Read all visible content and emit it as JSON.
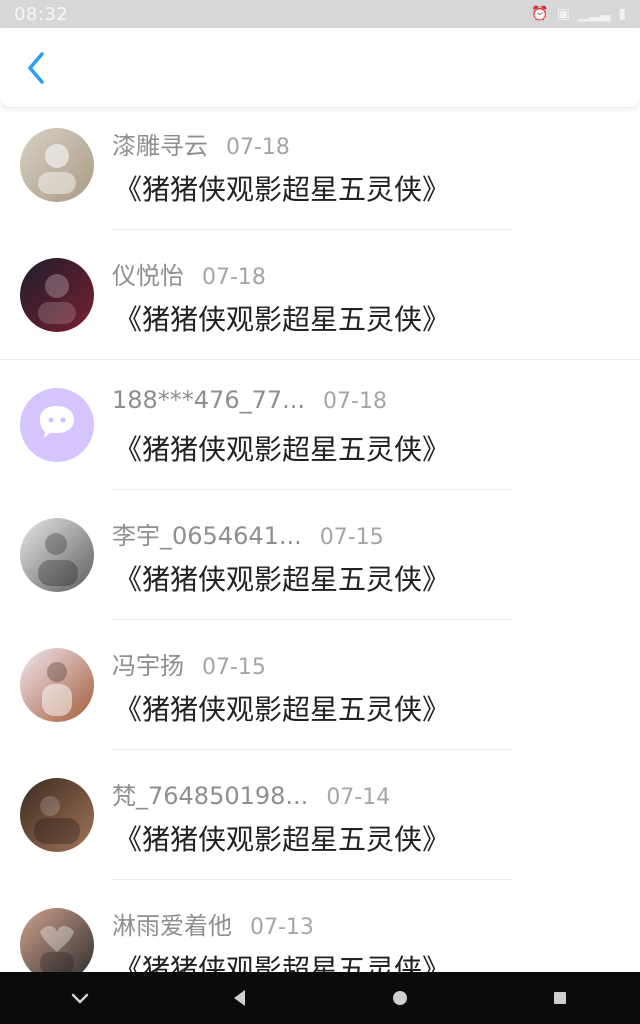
{
  "status_bar": {
    "time": "08:32",
    "icons": [
      "alarm-icon",
      "wifi-icon",
      "signal-icon",
      "battery-icon"
    ]
  },
  "header": {
    "back_icon": "chevron-left-icon"
  },
  "colors": {
    "accent": "#2a9df4",
    "name_text": "#8f8f8f",
    "date_text": "#a5a5a5",
    "message_text": "#222222"
  },
  "items": [
    {
      "name": "漆雕寻云",
      "date": "07-18",
      "message": "《猪猪侠观影超星五灵侠》",
      "avatar_color_a": "#d8d1c6",
      "avatar_color_b": "#a99a84"
    },
    {
      "name": "仪悦怡",
      "date": "07-18",
      "message": "《猪猪侠观影超星五灵侠》",
      "avatar_color_a": "#1d1d2d",
      "avatar_color_b": "#7a2030"
    },
    {
      "name": "188***476_77...",
      "date": "07-18",
      "message": "《猪猪侠观影超星五灵侠》",
      "avatar_color_a": "#d8c8ff",
      "avatar_color_b": "#bfa7ff"
    },
    {
      "name": "李宇_0654641...",
      "date": "07-15",
      "message": "《猪猪侠观影超星五灵侠》",
      "avatar_color_a": "#e7e7e7",
      "avatar_color_b": "#5d5d5d"
    },
    {
      "name": "冯宇扬",
      "date": "07-15",
      "message": "《猪猪侠观影超星五灵侠》",
      "avatar_color_a": "#f2e7f1",
      "avatar_color_b": "#a35c38"
    },
    {
      "name": "梵_764850198...",
      "date": "07-14",
      "message": "《猪猪侠观影超星五灵侠》",
      "avatar_color_a": "#3a2a1f",
      "avatar_color_b": "#a47458"
    },
    {
      "name": "淋雨爱着他",
      "date": "07-13",
      "message": "《猪猪侠观影超星五灵侠》",
      "avatar_color_a": "#d1a28e",
      "avatar_color_b": "#2c2c2c"
    }
  ],
  "nav_bar": {
    "icons": [
      "chevron-down-icon",
      "back-triangle-icon",
      "home-circle-icon",
      "recents-square-icon"
    ]
  }
}
